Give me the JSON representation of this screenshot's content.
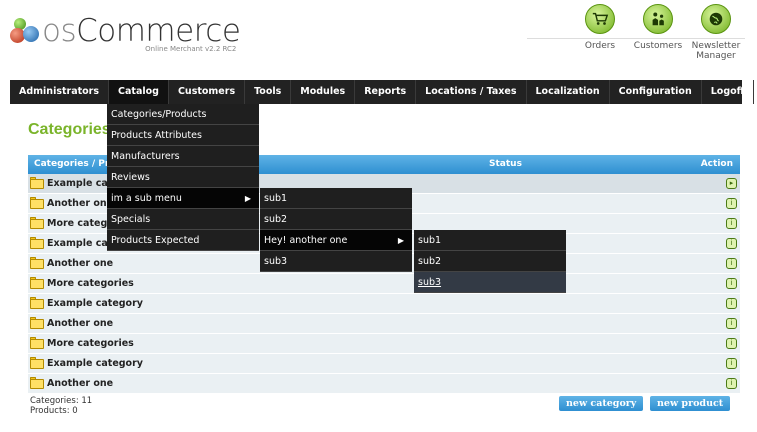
{
  "logo": {
    "word_os": "os",
    "word_commerce": "Commerce",
    "subtitle": "Online Merchant v2.2 RC2"
  },
  "header_links": [
    {
      "label": "Orders",
      "icon": "cart-icon"
    },
    {
      "label": "Customers",
      "icon": "customers-icon"
    },
    {
      "label": "Newsletter Manager",
      "icon": "globe-icon"
    }
  ],
  "menu": [
    "Administrators",
    "Catalog",
    "Customers",
    "Tools",
    "Modules",
    "Reports",
    "Locations / Taxes",
    "Localization",
    "Configuration",
    "Logoff"
  ],
  "catalog_menu": [
    "Categories/Products",
    "Products Attributes",
    "Manufacturers",
    "Reviews",
    "im a sub menu",
    "Specials",
    "Products Expected"
  ],
  "submenu1": [
    "sub1",
    "sub2",
    "Hey! another one",
    "sub3"
  ],
  "submenu2": [
    "sub1",
    "sub2",
    "sub3"
  ],
  "page_title": "Categories",
  "table": {
    "col_name": "Categories / Products",
    "col_status": "Status",
    "col_action": "Action",
    "rows": [
      "Example category",
      "Another one",
      "More categories",
      "Example category",
      "Another one",
      "More categories",
      "Example category",
      "Another one",
      "More categories",
      "Example category",
      "Another one"
    ]
  },
  "footer": {
    "categories": "Categories: 11",
    "products": "Products: 0"
  },
  "buttons": {
    "new_category": "new category",
    "new_product": "new product"
  },
  "colors": {
    "accent_green": "#7ab42a",
    "header_blue": "#2e8fd1",
    "menu_bg": "#222222"
  }
}
